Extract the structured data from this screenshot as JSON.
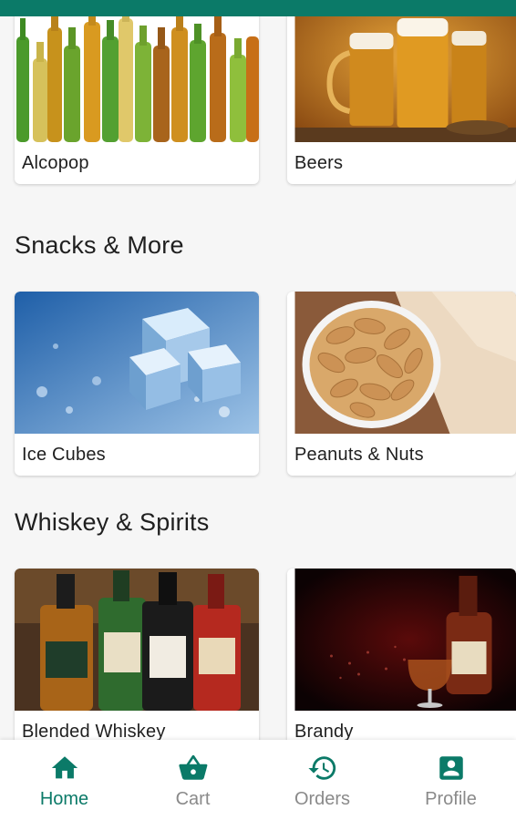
{
  "theme": {
    "accent": "#0b7a68",
    "inactive": "#8a8a8a",
    "background": "#f6f6f6"
  },
  "sections": [
    {
      "heading": "",
      "items": [
        {
          "label": "Alcopop",
          "image": "green-beer-bottles"
        },
        {
          "label": "Beers",
          "image": "beer-mugs"
        }
      ]
    },
    {
      "heading": "Snacks & More",
      "items": [
        {
          "label": "Ice Cubes",
          "image": "ice-cubes"
        },
        {
          "label": "Peanuts & Nuts",
          "image": "peanuts-bowl"
        }
      ]
    },
    {
      "heading": "Whiskey & Spirits",
      "items": [
        {
          "label": "Blended Whiskey",
          "image": "whiskey-bottles"
        },
        {
          "label": "Brandy",
          "image": "brandy-bottle-glass"
        }
      ]
    }
  ],
  "nav": [
    {
      "label": "Home",
      "icon": "home-icon",
      "active": true
    },
    {
      "label": "Cart",
      "icon": "basket-icon",
      "active": false
    },
    {
      "label": "Orders",
      "icon": "history-icon",
      "active": false
    },
    {
      "label": "Profile",
      "icon": "profile-icon",
      "active": false
    }
  ]
}
